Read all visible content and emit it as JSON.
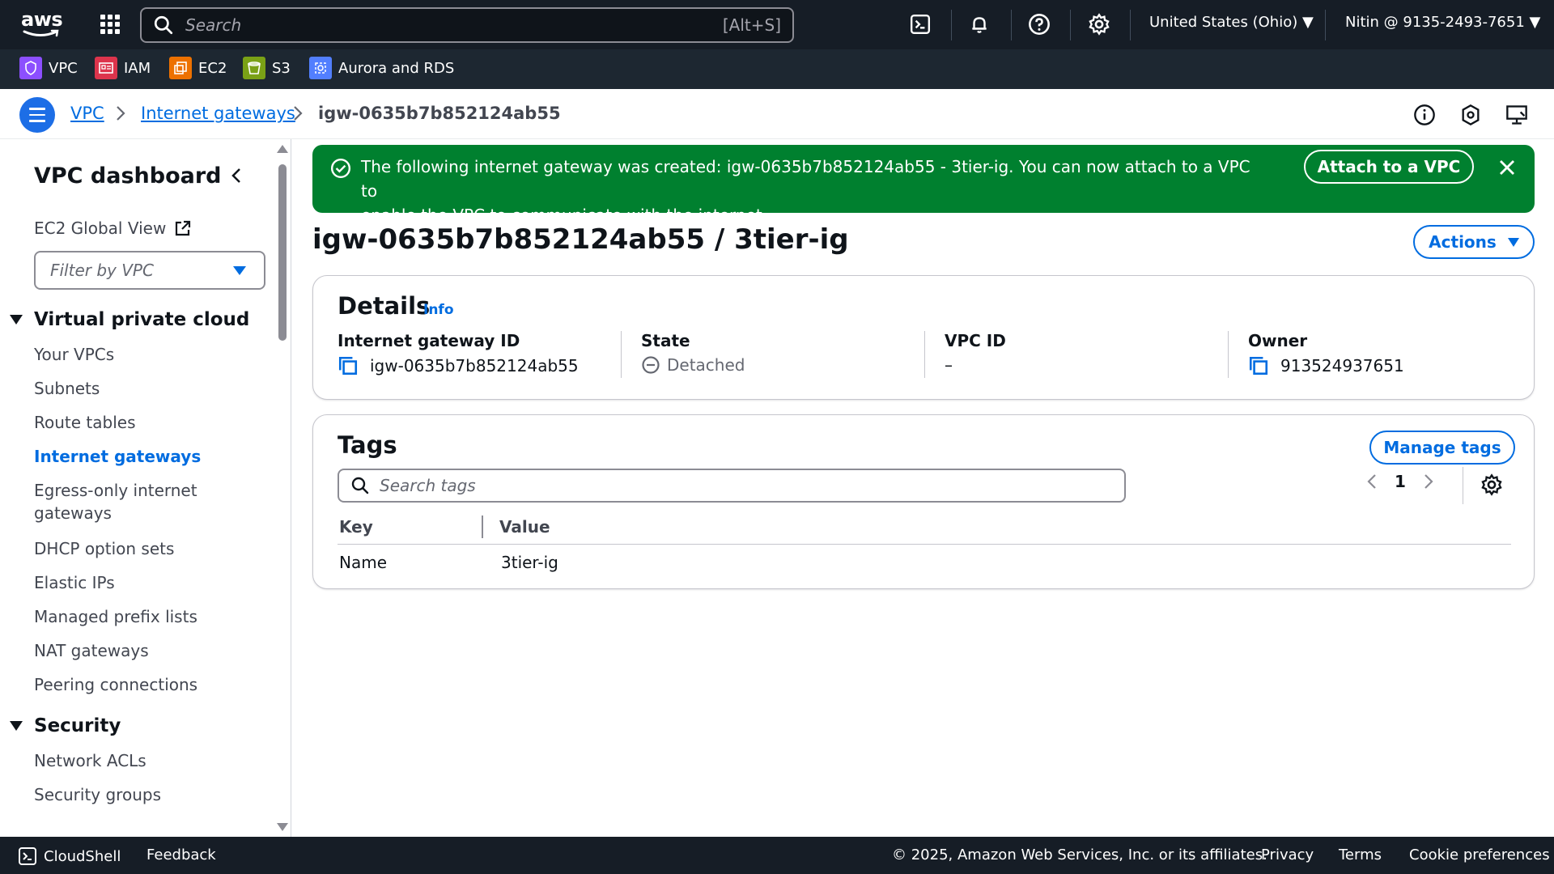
{
  "topnav": {
    "logo_text": "aws",
    "search_placeholder": "Search",
    "search_shortcut": "[Alt+S]",
    "region": "United States (Ohio) ▼",
    "account": "Nitin @ 9135-2493-7651 ▼"
  },
  "favorites": [
    {
      "label": "VPC",
      "color": "#8c4fff"
    },
    {
      "label": "IAM",
      "color": "#dd344c"
    },
    {
      "label": "EC2",
      "color": "#ed7100"
    },
    {
      "label": "S3",
      "color": "#7aa116"
    },
    {
      "label": "Aurora and RDS",
      "color": "#527fff"
    }
  ],
  "breadcrumb": {
    "items": [
      "VPC",
      "Internet gateways"
    ],
    "current": "igw-0635b7b852124ab55"
  },
  "sidebar": {
    "title": "VPC dashboard",
    "global_view": "EC2 Global View",
    "filter_placeholder": "Filter by VPC",
    "sections": [
      {
        "title": "Virtual private cloud",
        "items": [
          "Your VPCs",
          "Subnets",
          "Route tables",
          "Internet gateways",
          "Egress-only internet",
          "gateways",
          "DHCP option sets",
          "Elastic IPs",
          "Managed prefix lists",
          "NAT gateways",
          "Peering connections"
        ]
      },
      {
        "title": "Security",
        "items": [
          "Network ACLs",
          "Security groups"
        ]
      }
    ],
    "active_item": "Internet gateways"
  },
  "flash": {
    "line1": "The following internet gateway was created: igw-0635b7b852124ab55 - 3tier-ig. You can now attach to a VPC to",
    "line2": "enable the VPC to communicate with the internet.",
    "action": "Attach to a VPC",
    "color": "#00802f"
  },
  "page": {
    "title": "igw-0635b7b852124ab55 / 3tier-ig",
    "actions": "Actions"
  },
  "details": {
    "title": "Details",
    "info": "Info",
    "fields": [
      {
        "label": "Internet gateway ID",
        "value": "igw-0635b7b852124ab55"
      },
      {
        "label": "State",
        "value": "Detached"
      },
      {
        "label": "VPC ID",
        "value": "–"
      },
      {
        "label": "Owner",
        "value": "913524937651"
      }
    ]
  },
  "tags": {
    "title": "Tags",
    "manage": "Manage tags",
    "search_placeholder": "Search tags",
    "page": "1",
    "columns": [
      "Key",
      "Value"
    ],
    "rows": [
      {
        "key": "Name",
        "value": "3tier-ig"
      }
    ]
  },
  "footer": {
    "cloudshell": "CloudShell",
    "feedback": "Feedback",
    "copyright": "© 2025, Amazon Web Services, Inc. or its affiliates.",
    "privacy": "Privacy",
    "terms": "Terms",
    "cookies": "Cookie preferences"
  }
}
